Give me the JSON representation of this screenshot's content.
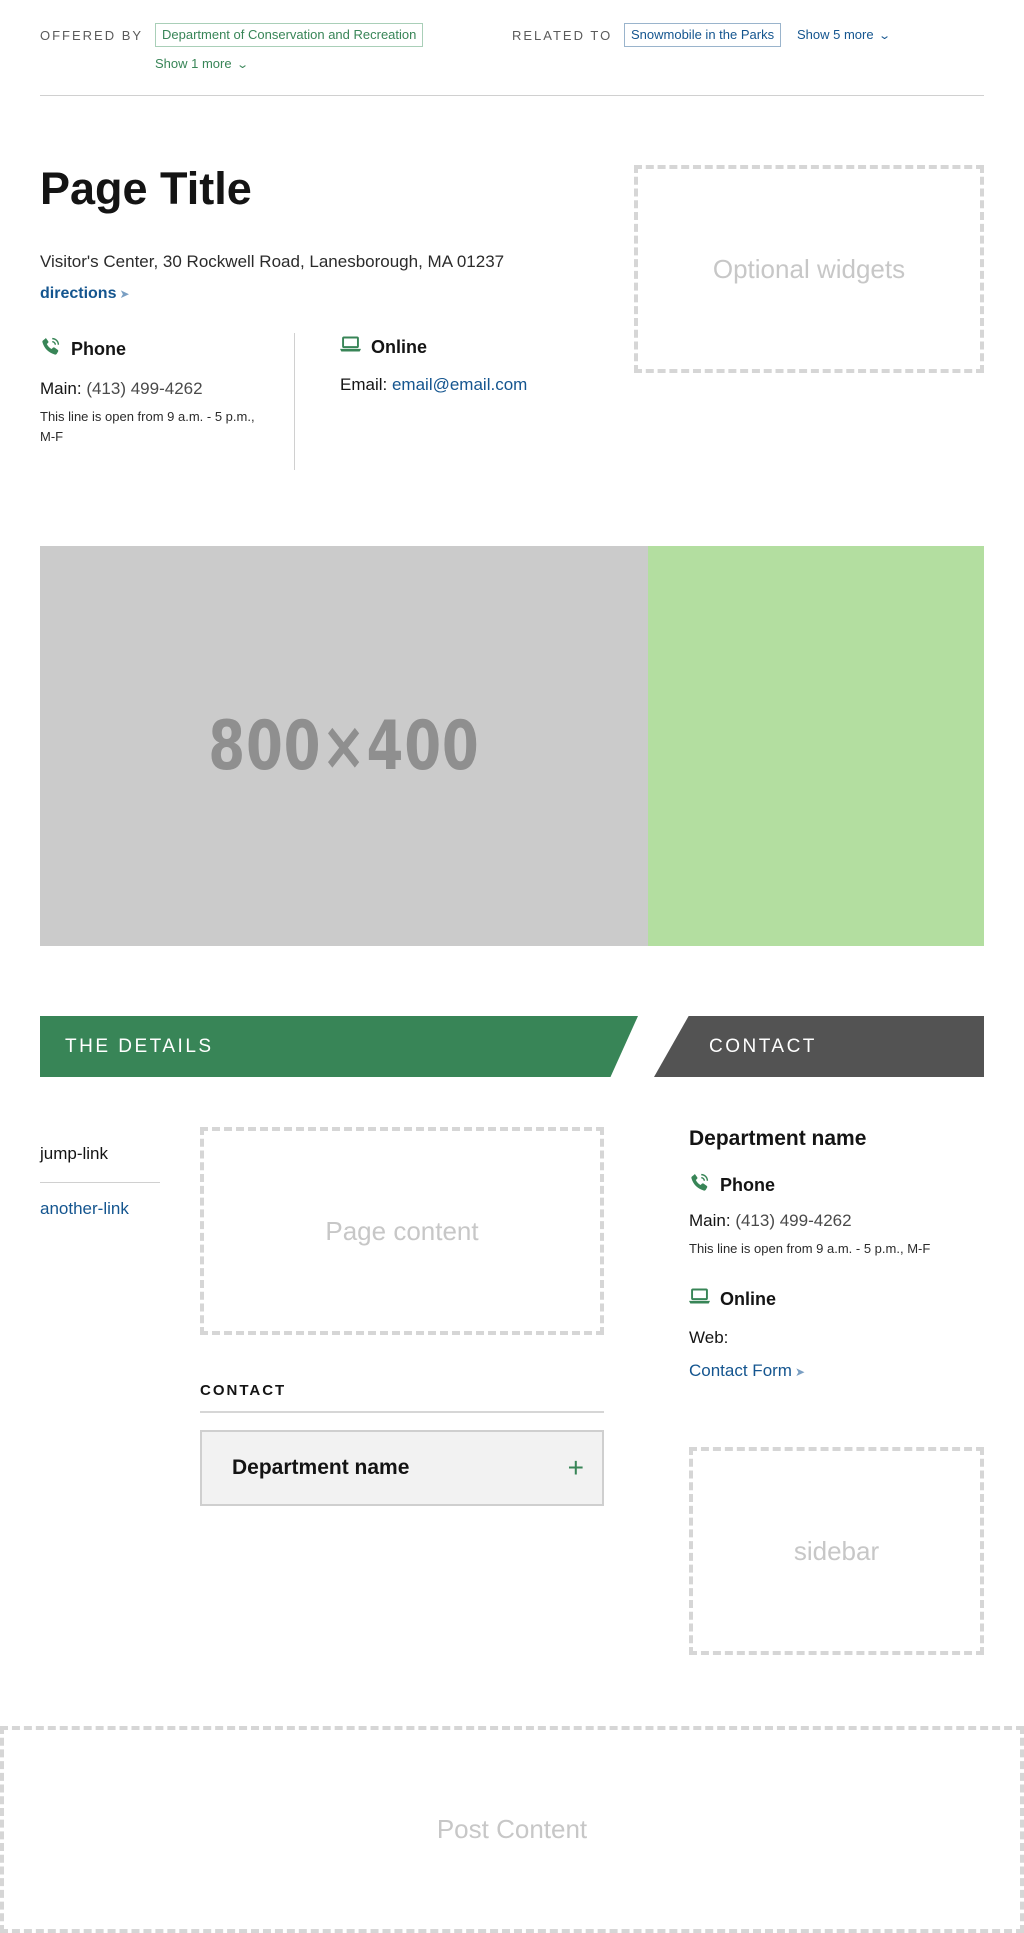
{
  "relationships": {
    "offered_by_label": "OFFERED BY",
    "offered_by_tag": "Department of Conservation and Recreation",
    "offered_more": "Show 1 more",
    "related_to_label": "RELATED TO",
    "related_to_tag": "Snowmobile in the Parks",
    "related_more": "Show 5 more"
  },
  "header": {
    "title": "Page Title",
    "address": "Visitor's Center, 30 Rockwell Road, Lanesborough, MA 01237",
    "directions": "directions",
    "phone": {
      "title": "Phone",
      "main_label": "Main",
      "main_value": "(413) 499-4262",
      "note": "This line is open from 9 a.m. - 5 p.m., M-F"
    },
    "online": {
      "title": "Online",
      "email_label": "Email",
      "email_value": "email@email.com"
    },
    "widget_text": "Optional widgets"
  },
  "hero": {
    "placeholder_text": "800×400",
    "image_color": "#cbcbcb",
    "accent_color": "#b3dea0"
  },
  "sections": {
    "details_label": "THE DETAILS",
    "contact_label": "CONTACT"
  },
  "jump_links": [
    "jump-link",
    "another-link"
  ],
  "content": {
    "page_content_text": "Page content",
    "contact_heading": "CONTACT",
    "accordion_label": "Department name",
    "accordion_toggle": "+"
  },
  "contact_sidebar": {
    "department": "Department name",
    "phone_title": "Phone",
    "main_label": "Main",
    "main_value": "(413) 499-4262",
    "note": "This line is open from 9 a.m. - 5 p.m., M-F",
    "online_title": "Online",
    "web_label": "Web:",
    "form_link": "Contact Form",
    "sidebar_text": "sidebar"
  },
  "post_content_text": "Post Content",
  "colors": {
    "brand_green": "#388557",
    "link_blue": "#14558f",
    "dark_gray": "#535353"
  },
  "icons": [
    "phone-icon",
    "laptop-icon",
    "chevron-down-icon",
    "arrow-right-icon",
    "plus-icon"
  ]
}
